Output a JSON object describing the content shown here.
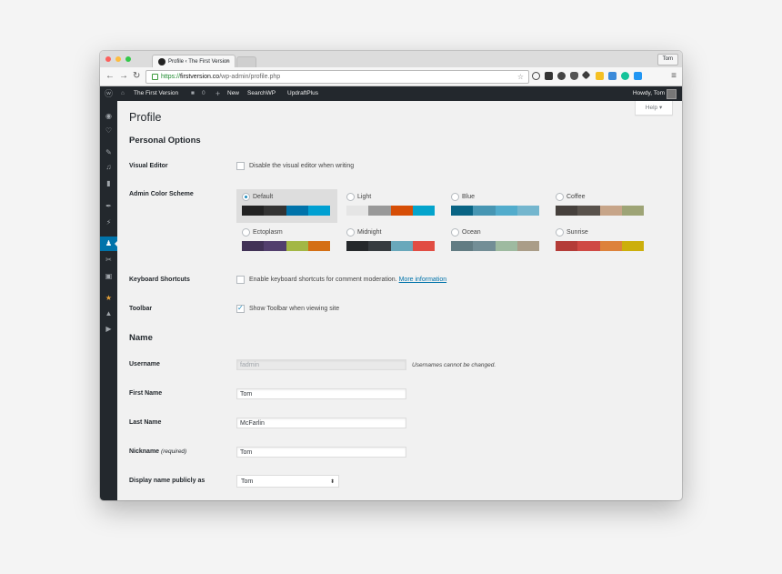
{
  "browser": {
    "tab_title": "Profile ‹ The First Version",
    "tab_close": "×",
    "profile_button": "Tom",
    "url_secure": "https://",
    "url_host": "firstversion.co",
    "url_path": "/wp-admin/profile.php"
  },
  "adminbar": {
    "site_name": "The First Version",
    "comments_count": "0",
    "new_label": "New",
    "link1": "SearchWP",
    "link2": "UpdraftPlus",
    "greeting": "Howdy, Tom"
  },
  "page": {
    "help_tab": "Help ▾",
    "title": "Profile",
    "section_personal": "Personal Options",
    "visual_editor_label": "Visual Editor",
    "visual_editor_text": "Disable the visual editor when writing",
    "color_scheme_label": "Admin Color Scheme",
    "keyboard_label": "Keyboard Shortcuts",
    "keyboard_text": "Enable keyboard shortcuts for comment moderation.",
    "keyboard_link": "More information",
    "toolbar_label": "Toolbar",
    "toolbar_text": "Show Toolbar when viewing site",
    "section_name": "Name",
    "username_label": "Username",
    "username_value": "fadmin",
    "username_note": "Usernames cannot be changed.",
    "firstname_label": "First Name",
    "firstname_value": "Tom",
    "lastname_label": "Last Name",
    "lastname_value": "McFarlin",
    "nickname_label": "Nickname",
    "nickname_required": "(required)",
    "nickname_value": "Tom",
    "display_label": "Display name publicly as",
    "display_value": "Tom"
  },
  "schemes": [
    {
      "name": "Default",
      "selected": true,
      "colors": [
        "#222222",
        "#333333",
        "#0073aa",
        "#00a0d2"
      ]
    },
    {
      "name": "Light",
      "selected": false,
      "colors": [
        "#e5e5e5",
        "#999999",
        "#d64e07",
        "#04a4cc"
      ]
    },
    {
      "name": "Blue",
      "selected": false,
      "colors": [
        "#096484",
        "#4796b3",
        "#52accc",
        "#74b6ce"
      ]
    },
    {
      "name": "Coffee",
      "selected": false,
      "colors": [
        "#46403c",
        "#59524c",
        "#c7a589",
        "#9ea476"
      ]
    },
    {
      "name": "Ectoplasm",
      "selected": false,
      "colors": [
        "#413256",
        "#523f6d",
        "#a3b745",
        "#d46f15"
      ]
    },
    {
      "name": "Midnight",
      "selected": false,
      "colors": [
        "#25282b",
        "#363b3f",
        "#69a8bb",
        "#e14d43"
      ]
    },
    {
      "name": "Ocean",
      "selected": false,
      "colors": [
        "#627c83",
        "#738e96",
        "#9ebaa0",
        "#aa9d88"
      ]
    },
    {
      "name": "Sunrise",
      "selected": false,
      "colors": [
        "#b43c38",
        "#cf4944",
        "#dd823b",
        "#ccaf0b"
      ]
    }
  ],
  "checkboxes": {
    "visual_editor": false,
    "keyboard": false,
    "toolbar": true
  },
  "sidebar_icons": [
    "dashboard-icon",
    "paint-icon",
    "pin-icon",
    "media-icon",
    "pages-icon",
    "comments-icon",
    "appearance-icon",
    "users-icon",
    "tools-icon",
    "settings-icon",
    "star-icon",
    "lock-icon",
    "play-icon"
  ]
}
